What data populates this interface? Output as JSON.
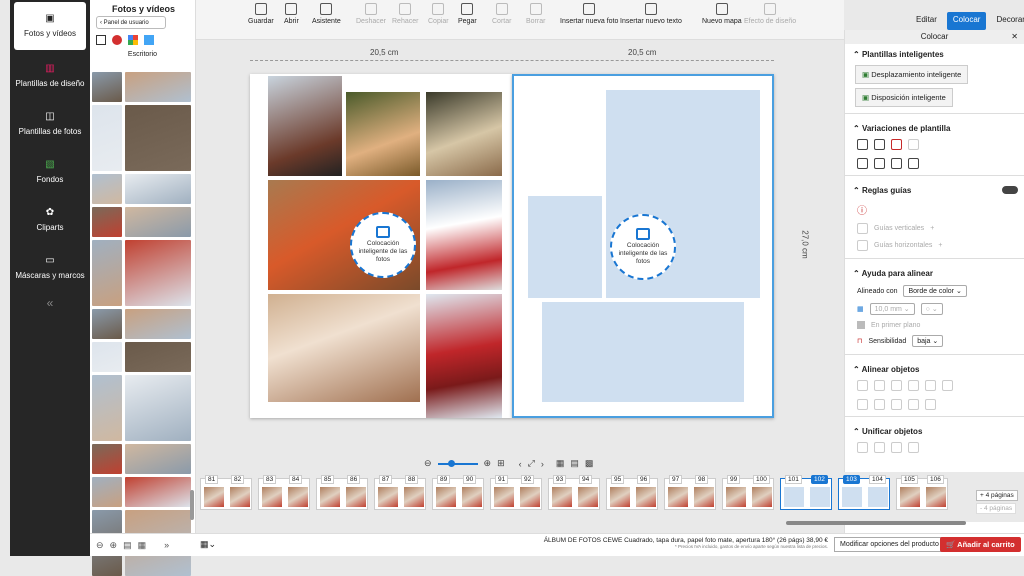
{
  "nav": {
    "items": [
      {
        "label": "Fotos y vídeos",
        "icon": "photo-icon",
        "active": true
      },
      {
        "label": "Plantillas de diseño",
        "icon": "book-icon"
      },
      {
        "label": "Plantillas de fotos",
        "icon": "layout-icon"
      },
      {
        "label": "Fondos",
        "icon": "background-icon"
      },
      {
        "label": "Cliparts",
        "icon": "clipart-icon"
      },
      {
        "label": "Máscaras y marcos",
        "icon": "mask-icon"
      }
    ],
    "collapse_glyph": "«"
  },
  "photos": {
    "title": "Fotos y vídeos",
    "user_panel": "Panel de usuario",
    "folder": "Escritorio"
  },
  "toolbar": {
    "items": [
      {
        "label": "Guardar",
        "enabled": true
      },
      {
        "label": "Abrir",
        "enabled": true
      },
      {
        "label": "Asistente",
        "enabled": true
      },
      {
        "label": "Deshacer",
        "enabled": false
      },
      {
        "label": "Rehacer",
        "enabled": false
      },
      {
        "label": "Copiar",
        "enabled": false
      },
      {
        "label": "Pegar",
        "enabled": true
      },
      {
        "label": "Cortar",
        "enabled": false
      },
      {
        "label": "Borrar",
        "enabled": false
      },
      {
        "label": "Insertar nueva foto",
        "enabled": true
      },
      {
        "label": "Insertar nuevo texto",
        "enabled": true
      },
      {
        "label": "Nuevo mapa",
        "enabled": true
      },
      {
        "label": "Efecto de diseño",
        "enabled": false
      }
    ]
  },
  "modes": [
    "Editar",
    "Colocar",
    "Decorar"
  ],
  "active_mode": "Colocar",
  "canvas": {
    "width_left": "20,5 cm",
    "width_right": "20,5 cm",
    "height": "27,0 cm",
    "smart_label": "Colocación inteligente de las fotos"
  },
  "right_panel": {
    "title": "Colocar",
    "smart_templates": "Plantillas inteligentes",
    "smart_move": "Desplazamiento inteligente",
    "smart_layout": "Disposición inteligente",
    "variations": "Variaciones de plantilla",
    "guides": "Reglas guías",
    "v_guides": "Guías verticales",
    "h_guides": "Guías horizontales",
    "align_help": "Ayuda para alinear",
    "align_with": "Alineado con",
    "align_with_value": "Borde de color",
    "distance": "10,0 mm",
    "foreground": "En primer plano",
    "sensitivity": "Sensibilidad",
    "sensitivity_value": "baja",
    "align_objects": "Alinear objetos",
    "unify": "Unificar objetos"
  },
  "strip": {
    "pages": [
      "81",
      "82",
      "83",
      "84",
      "85",
      "86",
      "87",
      "88",
      "89",
      "90",
      "91",
      "92",
      "93",
      "94",
      "95",
      "96",
      "97",
      "98",
      "99",
      "100",
      "101",
      "102",
      "103",
      "104",
      "105",
      "106"
    ],
    "selected": [
      "102",
      "103"
    ],
    "add_pages": "+ 4 páginas",
    "remove_pages": "- 4 páginas"
  },
  "bottom": {
    "product": "ÁLBUM DE FOTOS CEWE Cuadrado, tapa dura, papel foto mate, apertura 180° (26 págs) 38,90 €",
    "note": "* Precios IVA incluido, gastos de envío aparte según nuestra lista de precios.",
    "modify": "Modificar opciones del producto",
    "cart": "Añadir al carrito"
  },
  "colors": {
    "accent": "#1976d2",
    "cart": "#d32f2f",
    "nav_bg": "#262626"
  }
}
